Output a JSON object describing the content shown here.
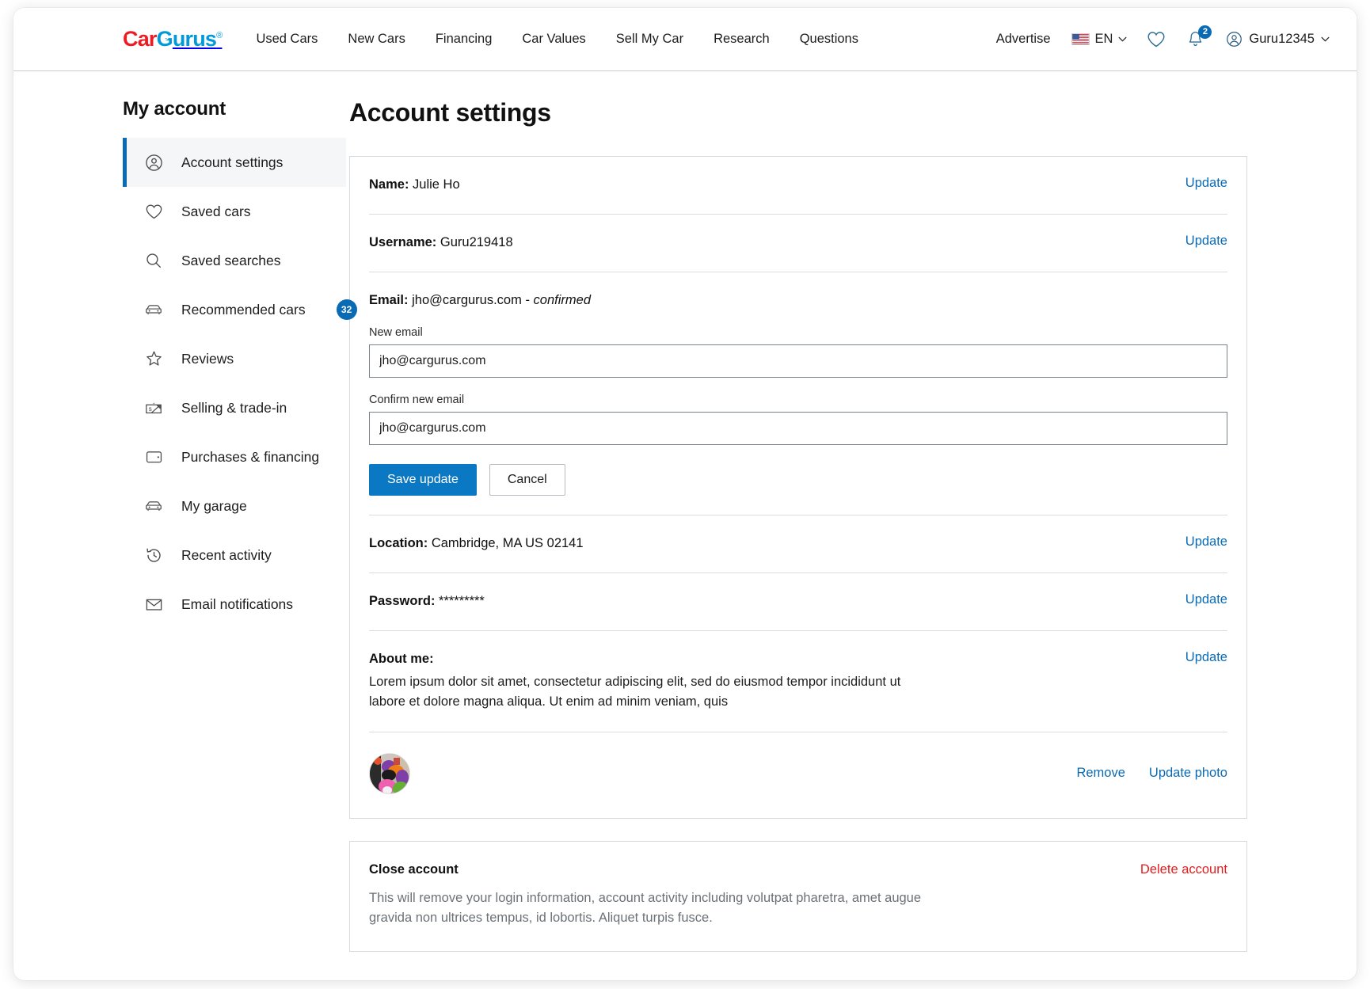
{
  "brand": {
    "name_part1": "Car",
    "name_part2": "urus",
    "registered": "®",
    "color_red": "#ed1c24",
    "color_blue": "#009ada"
  },
  "header": {
    "nav": [
      {
        "label": "Used Cars"
      },
      {
        "label": "New Cars"
      },
      {
        "label": "Financing"
      },
      {
        "label": "Car Values"
      },
      {
        "label": "Sell My Car"
      },
      {
        "label": "Research"
      },
      {
        "label": "Questions"
      }
    ],
    "advertise": "Advertise",
    "language": "EN",
    "notifications_count": "2",
    "username": "Guru12345"
  },
  "sidebar": {
    "title": "My account",
    "items": [
      {
        "label": "Account settings",
        "icon": "user-circle-icon",
        "active": true,
        "badge": ""
      },
      {
        "label": "Saved cars",
        "icon": "heart-icon",
        "active": false,
        "badge": ""
      },
      {
        "label": "Saved searches",
        "icon": "search-icon",
        "active": false,
        "badge": ""
      },
      {
        "label": "Recommended cars",
        "icon": "car-icon",
        "active": false,
        "badge": "32"
      },
      {
        "label": "Reviews",
        "icon": "star-icon",
        "active": false,
        "badge": ""
      },
      {
        "label": "Selling & trade-in",
        "icon": "money-tag-icon",
        "active": false,
        "badge": ""
      },
      {
        "label": "Purchases & financing",
        "icon": "wallet-icon",
        "active": false,
        "badge": ""
      },
      {
        "label": "My garage",
        "icon": "car-icon",
        "active": false,
        "badge": ""
      },
      {
        "label": "Recent activity",
        "icon": "history-icon",
        "active": false,
        "badge": ""
      },
      {
        "label": "Email notifications",
        "icon": "envelope-icon",
        "active": false,
        "badge": ""
      }
    ]
  },
  "main": {
    "page_title": "Account settings",
    "update_label": "Update",
    "name": {
      "label": "Name:",
      "value": "Julie Ho"
    },
    "username": {
      "label": "Username:",
      "value": "Guru219418"
    },
    "email": {
      "label": "Email:",
      "value": "jho@cargurus.com",
      "separator": "-",
      "status": "confirmed",
      "new_email_label": "New email",
      "new_email_value": "jho@cargurus.com",
      "confirm_email_label": "Confirm new email",
      "confirm_email_value": "jho@cargurus.com",
      "save_label": "Save update",
      "cancel_label": "Cancel"
    },
    "location": {
      "label": "Location:",
      "value": "Cambridge, MA US 02141"
    },
    "password": {
      "label": "Password:",
      "value": "*********"
    },
    "about": {
      "label": "About me:",
      "text": "Lorem ipsum dolor sit amet, consectetur adipiscing elit, sed do eiusmod tempor incididunt ut labore et dolore magna aliqua. Ut enim ad minim veniam, quis"
    },
    "photo": {
      "remove_label": "Remove",
      "update_label": "Update photo"
    },
    "close_account": {
      "title": "Close account",
      "delete_label": "Delete account",
      "description": "This will remove your login information, account activity including volutpat pharetra, amet augue gravida non ultrices tempus, id lobortis. Aliquet turpis fusce."
    }
  },
  "colors": {
    "accent_blue": "#0a6bb5",
    "button_blue": "#0a78c2",
    "danger_red": "#e01d1d"
  }
}
